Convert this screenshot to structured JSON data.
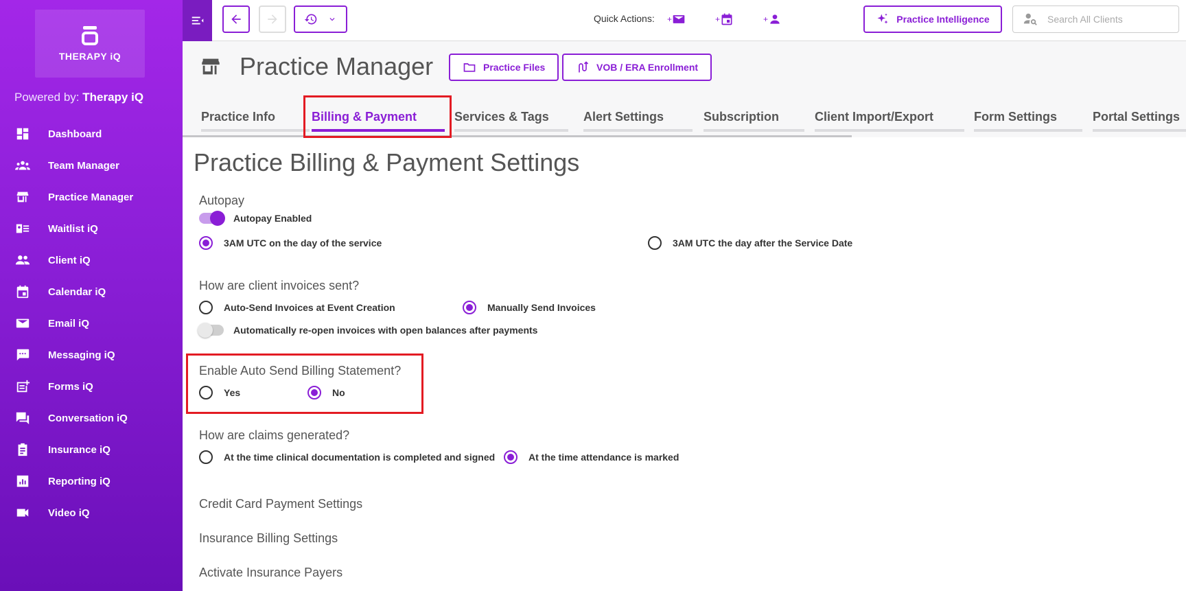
{
  "app": {
    "logo_text": "THERAPY iQ",
    "powered_prefix": "Powered by:",
    "powered_brand": "Therapy iQ"
  },
  "sidebar": {
    "items": [
      {
        "label": "Dashboard",
        "icon": "dashboard-icon"
      },
      {
        "label": "Team Manager",
        "icon": "team-icon"
      },
      {
        "label": "Practice Manager",
        "icon": "store-icon"
      },
      {
        "label": "Waitlist iQ",
        "icon": "waitlist-icon"
      },
      {
        "label": "Client iQ",
        "icon": "people-icon"
      },
      {
        "label": "Calendar iQ",
        "icon": "calendar-icon"
      },
      {
        "label": "Email iQ",
        "icon": "mail-icon"
      },
      {
        "label": "Messaging iQ",
        "icon": "message-icon"
      },
      {
        "label": "Forms iQ",
        "icon": "form-add-icon"
      },
      {
        "label": "Conversation iQ",
        "icon": "forum-icon"
      },
      {
        "label": "Insurance iQ",
        "icon": "clipboard-icon"
      },
      {
        "label": "Reporting iQ",
        "icon": "report-icon"
      },
      {
        "label": "Video iQ",
        "icon": "video-icon"
      }
    ]
  },
  "topbar": {
    "quick_actions_label": "Quick Actions:",
    "practice_intelligence_label": "Practice Intelligence",
    "search_placeholder": "Search All Clients"
  },
  "header": {
    "title": "Practice Manager",
    "practice_files_label": "Practice Files",
    "vob_label": "VOB / ERA Enrollment",
    "tabs": [
      {
        "label": "Practice Info"
      },
      {
        "label": "Billing & Payment"
      },
      {
        "label": "Services & Tags"
      },
      {
        "label": "Alert Settings"
      },
      {
        "label": "Subscription"
      },
      {
        "label": "Client Import/Export"
      },
      {
        "label": "Form Settings"
      },
      {
        "label": "Portal Settings"
      }
    ],
    "active_tab": "Billing & Payment"
  },
  "content": {
    "page_title": "Practice Billing & Payment Settings",
    "autopay": {
      "title": "Autopay",
      "toggle_label": "Autopay Enabled",
      "toggle_on": true,
      "options": [
        "3AM UTC on the day of the service",
        "3AM UTC the day after the Service Date"
      ],
      "selected": "3AM UTC on the day of the service"
    },
    "invoices": {
      "title": "How are client invoices sent?",
      "options": [
        "Auto-Send Invoices at Event Creation",
        "Manually Send Invoices"
      ],
      "selected": "Manually Send Invoices",
      "reopen_label": "Automatically re-open invoices with open balances after payments",
      "reopen_on": false
    },
    "billing_statement": {
      "title": "Enable Auto Send Billing Statement?",
      "options": [
        "Yes",
        "No"
      ],
      "selected": "No"
    },
    "claims": {
      "title": "How are claims generated?",
      "options": [
        "At the time clinical documentation is completed and signed",
        "At the time attendance is marked"
      ],
      "selected": "At the time attendance is marked"
    },
    "sections": [
      "Credit Card Payment Settings",
      "Insurance Billing Settings",
      "Activate Insurance Payers"
    ]
  },
  "colors": {
    "accent": "#8a1ed6",
    "highlight": "#e31b23",
    "sidebar_top": "#a327e8",
    "sidebar_bottom": "#6a0fb8"
  }
}
